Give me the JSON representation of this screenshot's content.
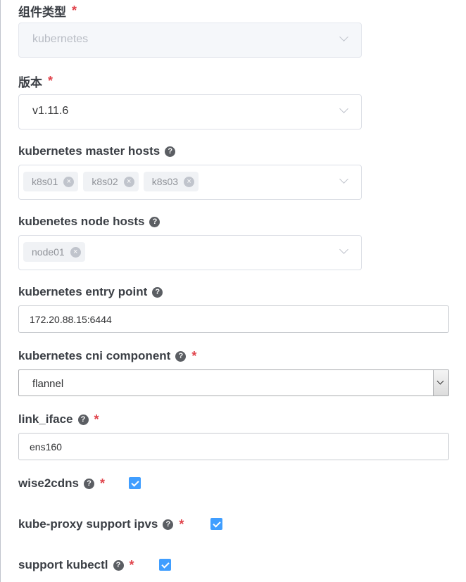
{
  "component_type": {
    "label": "组件类型",
    "required": "*",
    "value": "kubernetes"
  },
  "version": {
    "label": "版本",
    "required": "*",
    "value": "v1.11.6"
  },
  "master_hosts": {
    "label": "kubernetes master hosts",
    "help": "?",
    "tags": [
      "k8s01",
      "k8s02",
      "k8s03"
    ]
  },
  "node_hosts": {
    "label": "kubenetes node hosts",
    "help": "?",
    "tags": [
      "node01"
    ]
  },
  "entry_point": {
    "label": "kubernetes entry point",
    "help": "?",
    "value": "172.20.88.15:6444"
  },
  "cni_component": {
    "label": "kubernetes cni component",
    "help": "?",
    "required": "*",
    "value": "flannel"
  },
  "link_iface": {
    "label": "link_iface",
    "help": "?",
    "required": "*",
    "value": "ens160"
  },
  "wise2cdns": {
    "label": "wise2cdns",
    "help": "?",
    "required": "*",
    "checked": true
  },
  "ipvs": {
    "label": "kube-proxy support ipvs",
    "help": "?",
    "required": "*",
    "checked": true
  },
  "kubectl": {
    "label": "support kubectl",
    "help": "?",
    "required": "*",
    "checked": true
  },
  "colors": {
    "accent": "#409eff",
    "required": "#e0424a"
  }
}
